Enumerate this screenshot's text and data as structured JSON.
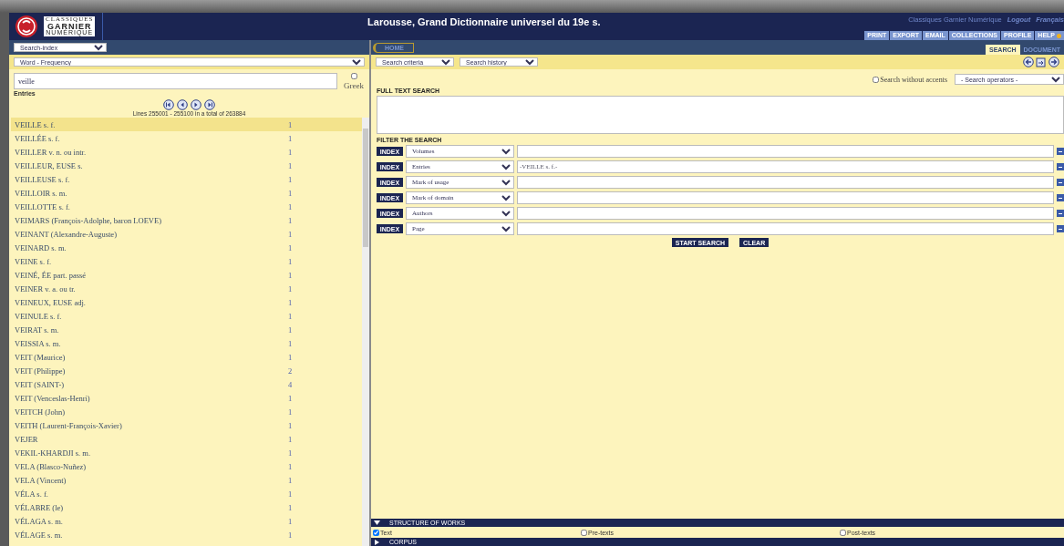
{
  "header": {
    "title": "Larousse, Grand Dictionnaire universel du 19e s.",
    "logo_lines": [
      "CLASSIQUES",
      "GARNIER",
      "NUMÉRIQUE"
    ],
    "links": [
      "Classiques Garnier Numérique",
      "Logout",
      "Français"
    ],
    "menu": [
      "PRINT",
      "EXPORT",
      "EMAIL",
      "COLLECTIONS",
      "PROFILE",
      "HELP"
    ]
  },
  "tabs": [
    {
      "label": "SEARCH",
      "selected": true
    },
    {
      "label": "DOCUMENT",
      "selected": false
    }
  ],
  "left": {
    "index_select": "Search-index",
    "order_select": "Word - Frequency",
    "search": {
      "value": "veille"
    },
    "greek": {
      "label": "Greek",
      "checked": false
    },
    "entries_label": "Entries",
    "lines_info": "Lines 255001 - 255100 in a total of 263884",
    "rows": [
      {
        "term": "VEILLE s. f.",
        "count": "1",
        "selected": true
      },
      {
        "term": "VEILLÉE s. f.",
        "count": "1",
        "selected": false
      },
      {
        "term": "VEILLER v. n. ou intr.",
        "count": "1",
        "selected": false
      },
      {
        "term": "VEILLEUR, EUSE s.",
        "count": "1",
        "selected": false
      },
      {
        "term": "VEILLEUSE s. f.",
        "count": "1",
        "selected": false
      },
      {
        "term": "VEILLOIR s. m.",
        "count": "1",
        "selected": false
      },
      {
        "term": "VEILLOTTE s. f.",
        "count": "1",
        "selected": false
      },
      {
        "term": "VEIMARS (François-Adolphe, baron LOEVE)",
        "count": "1",
        "selected": false
      },
      {
        "term": "VEINANT (Alexandre-Auguste)",
        "count": "1",
        "selected": false
      },
      {
        "term": "VEINARD s. m.",
        "count": "1",
        "selected": false
      },
      {
        "term": "VEINE s. f.",
        "count": "1",
        "selected": false
      },
      {
        "term": "VEINÉ, ÉE part. passé",
        "count": "1",
        "selected": false
      },
      {
        "term": "VEINER v. a. ou tr.",
        "count": "1",
        "selected": false
      },
      {
        "term": "VEINEUX, EUSE adj.",
        "count": "1",
        "selected": false
      },
      {
        "term": "VEINULE s. f.",
        "count": "1",
        "selected": false
      },
      {
        "term": "VEIRAT s. m.",
        "count": "1",
        "selected": false
      },
      {
        "term": "VEISSIA s. m.",
        "count": "1",
        "selected": false
      },
      {
        "term": "VEIT (Maurice)",
        "count": "1",
        "selected": false
      },
      {
        "term": "VEIT (Philippe)",
        "count": "2",
        "selected": false
      },
      {
        "term": "VEIT (SAINT-)",
        "count": "4",
        "selected": false
      },
      {
        "term": "VEIT (Venceslas-Henri)",
        "count": "1",
        "selected": false
      },
      {
        "term": "VEITCH (John)",
        "count": "1",
        "selected": false
      },
      {
        "term": "VEITH (Laurent-François-Xavier)",
        "count": "1",
        "selected": false
      },
      {
        "term": "VEJER",
        "count": "1",
        "selected": false
      },
      {
        "term": "VEKIL-KHARDJI s. m.",
        "count": "1",
        "selected": false
      },
      {
        "term": "VELA (Blasco-Nuñez)",
        "count": "1",
        "selected": false
      },
      {
        "term": "VELA (Vincent)",
        "count": "1",
        "selected": false
      },
      {
        "term": "VÉLA s. f.",
        "count": "1",
        "selected": false
      },
      {
        "term": "VÉLABRE (le)",
        "count": "1",
        "selected": false
      },
      {
        "term": "VÉLAGA s. m.",
        "count": "1",
        "selected": false
      },
      {
        "term": "VÉLAGE s. m.",
        "count": "1",
        "selected": false
      }
    ]
  },
  "right": {
    "home": "HOME",
    "criteria_select": "Search criteria",
    "history_select": "Search history",
    "accents": {
      "label": "Search without accents",
      "checked": false
    },
    "operators_select": "- Search operators -",
    "fulltext_label": "FULL TEXT SEARCH",
    "filter_label": "FILTER THE SEARCH",
    "filters": [
      {
        "button": "INDEX",
        "field": "Volumes"
      },
      {
        "button": "INDEX",
        "field": "Entries",
        "value": "-VEILLE s. f.-"
      },
      {
        "button": "INDEX",
        "field": "Mark of usage"
      },
      {
        "button": "INDEX",
        "field": "Mark of domain"
      },
      {
        "button": "INDEX",
        "field": "Authors"
      },
      {
        "button": "INDEX",
        "field": "Page"
      }
    ],
    "buttons": [
      "START SEARCH",
      "CLEAR"
    ],
    "structure": {
      "title": "STRUCTURE OF WORKS",
      "expanded": true,
      "options": [
        {
          "label": "Text",
          "checked": true
        },
        {
          "label": "Pre-texts",
          "checked": false
        },
        {
          "label": "Post-texts",
          "checked": false
        }
      ]
    },
    "corpus": {
      "title": "CORPUS",
      "expanded": false
    }
  }
}
